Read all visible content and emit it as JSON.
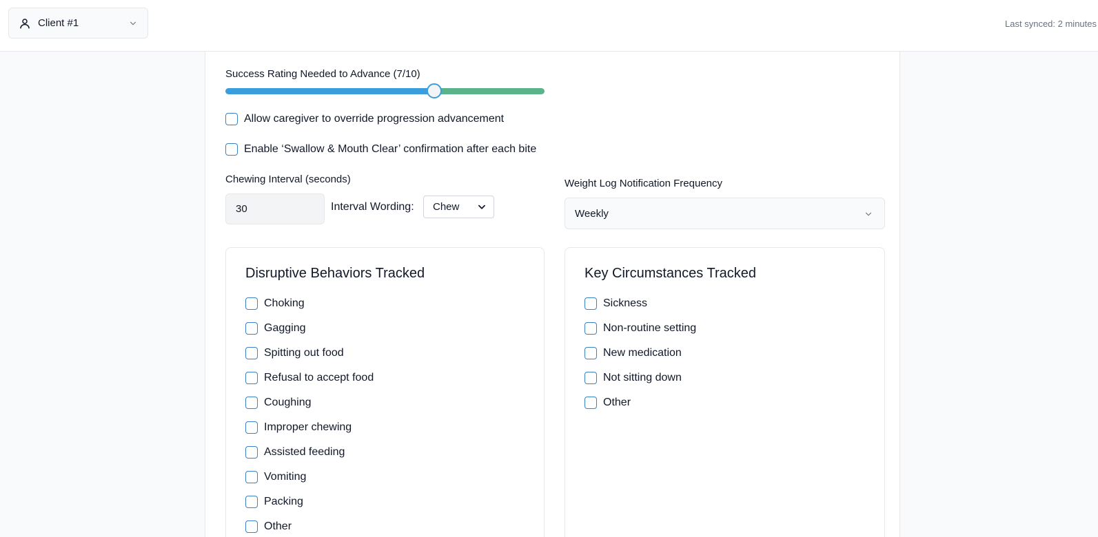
{
  "header": {
    "client_select": {
      "label": "Client #1",
      "icon": "user-icon"
    },
    "sync_status": "Last synced: 2 minutes"
  },
  "settings": {
    "success_rating": {
      "label": "Success Rating Needed to Advance (7/10)",
      "value": 7,
      "max": 10,
      "colors": {
        "left": "#3b9edb",
        "right": "#5ab38a"
      }
    },
    "override_checkbox": {
      "label": "Allow caregiver to override progression advancement",
      "checked": false
    },
    "swallow_checkbox": {
      "label": "Enable ‘Swallow & Mouth Clear’ confirmation after each bite",
      "checked": false
    },
    "chewing_interval": {
      "label": "Chewing Interval (seconds)",
      "value": "30"
    },
    "interval_wording": {
      "label": "Interval Wording:",
      "value": "Chew"
    },
    "weight_log": {
      "label": "Weight Log Notification Frequency",
      "value": "Weekly"
    }
  },
  "disruptive": {
    "title": "Disruptive Behaviors Tracked",
    "items": [
      "Choking",
      "Gagging",
      "Spitting out food",
      "Refusal to accept food",
      "Coughing",
      "Improper chewing",
      "Assisted feeding",
      "Vomiting",
      "Packing",
      "Other"
    ]
  },
  "circumstances": {
    "title": "Key Circumstances Tracked",
    "items": [
      "Sickness",
      "Non-routine setting",
      "New medication",
      "Not sitting down",
      "Other"
    ]
  }
}
